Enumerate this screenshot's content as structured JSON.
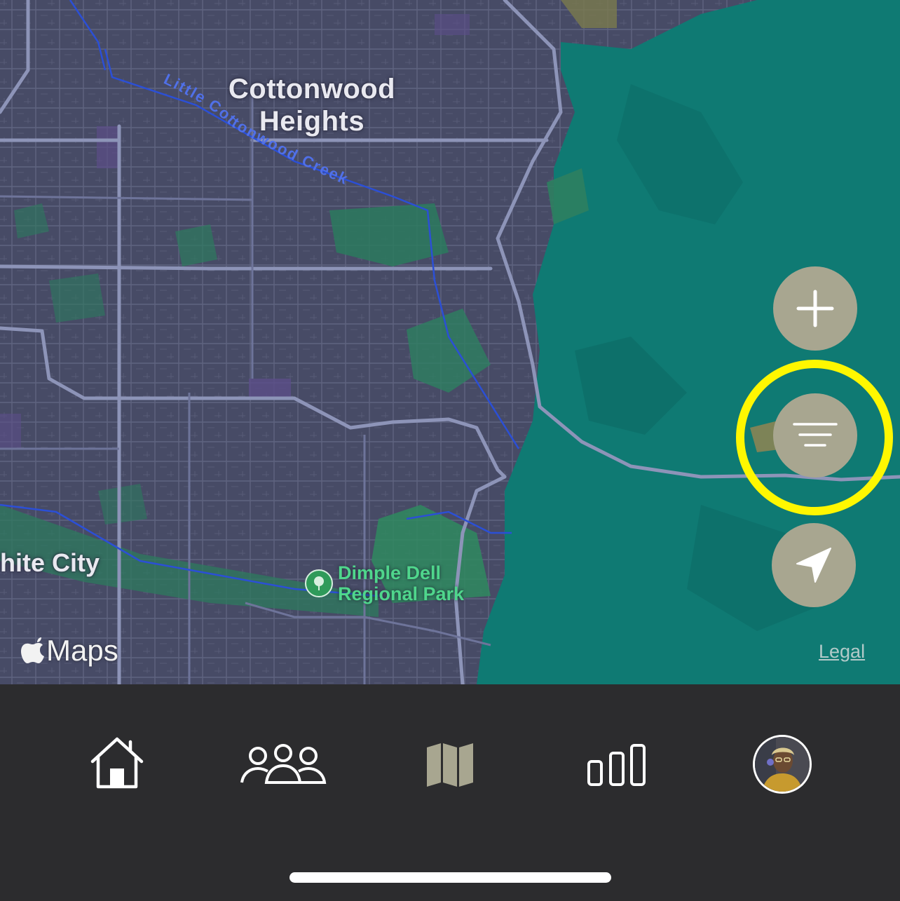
{
  "map": {
    "labels": {
      "city_north_line1": "Cottonwood",
      "city_north_line2": "Heights",
      "city_west": "hite City",
      "creek": "Little Cottonwood Creek",
      "park_line1": "Dimple Dell",
      "park_line2": "Regional Park"
    },
    "attribution": "Maps",
    "legal": "Legal",
    "colors": {
      "urban": "#474b66",
      "mountain": "#0f7a73",
      "park": "#2f8a5f",
      "highlight": "#fff700",
      "button": "#a8a690"
    }
  },
  "controls": {
    "add_icon": "plus-icon",
    "filter_icon": "filter-lines-icon",
    "locate_icon": "location-arrow-icon"
  },
  "tabbar": {
    "tabs": [
      {
        "icon": "home-icon"
      },
      {
        "icon": "people-icon"
      },
      {
        "icon": "map-icon",
        "active": true
      },
      {
        "icon": "bar-chart-icon"
      },
      {
        "icon": "avatar-profile"
      }
    ]
  }
}
